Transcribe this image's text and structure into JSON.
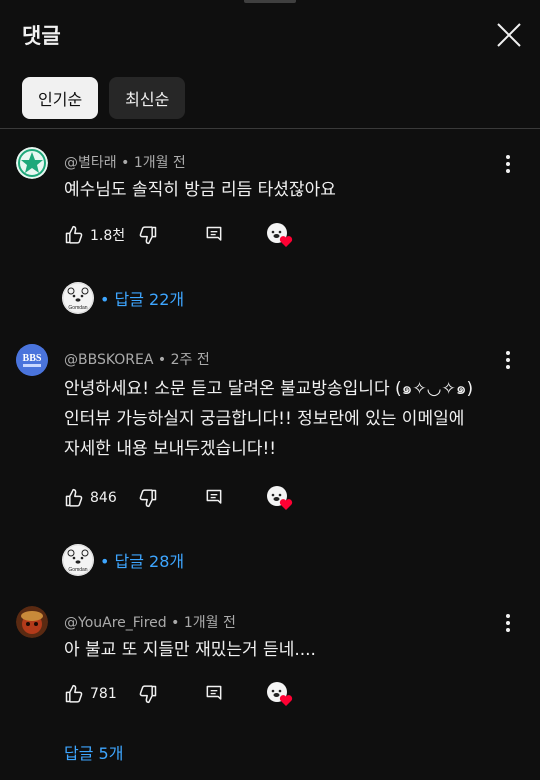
{
  "header": {
    "title": "댓글"
  },
  "sort_chips": [
    "인기순",
    "최신순"
  ],
  "colors": {
    "accent": "#3ea6ff",
    "heart": "#ff0033",
    "background": "#0f0f0f"
  },
  "comments": [
    {
      "author": "@별타래",
      "time": "1개월 전",
      "lines": [
        "예수님도 솔직히 방금 리듬 타셨잖아요"
      ],
      "likes": "1.8천",
      "replies_label": "답글 22개",
      "reply_avatar_text": "Gomdan"
    },
    {
      "author": "@BBSKOREA",
      "time": "2주 전",
      "lines": [
        "안녕하세요! 소문 듣고 달려온 불교방송입니다 (๑✧◡✧๑)",
        "인터뷰 가능하실지 궁금합니다!! 정보란에 있는 이메일에",
        "자세한 내용 보내두겠습니다!!"
      ],
      "likes": "846",
      "replies_label": "답글 28개",
      "avatar_text": "BBS",
      "reply_avatar_text": "Gomdan"
    },
    {
      "author": "@YouAre_Fired",
      "time": "1개월 전",
      "lines": [
        "아 불교 또 지들만 재밌는거 듣네...."
      ],
      "likes": "781",
      "replies_label": "답글 5개"
    }
  ]
}
